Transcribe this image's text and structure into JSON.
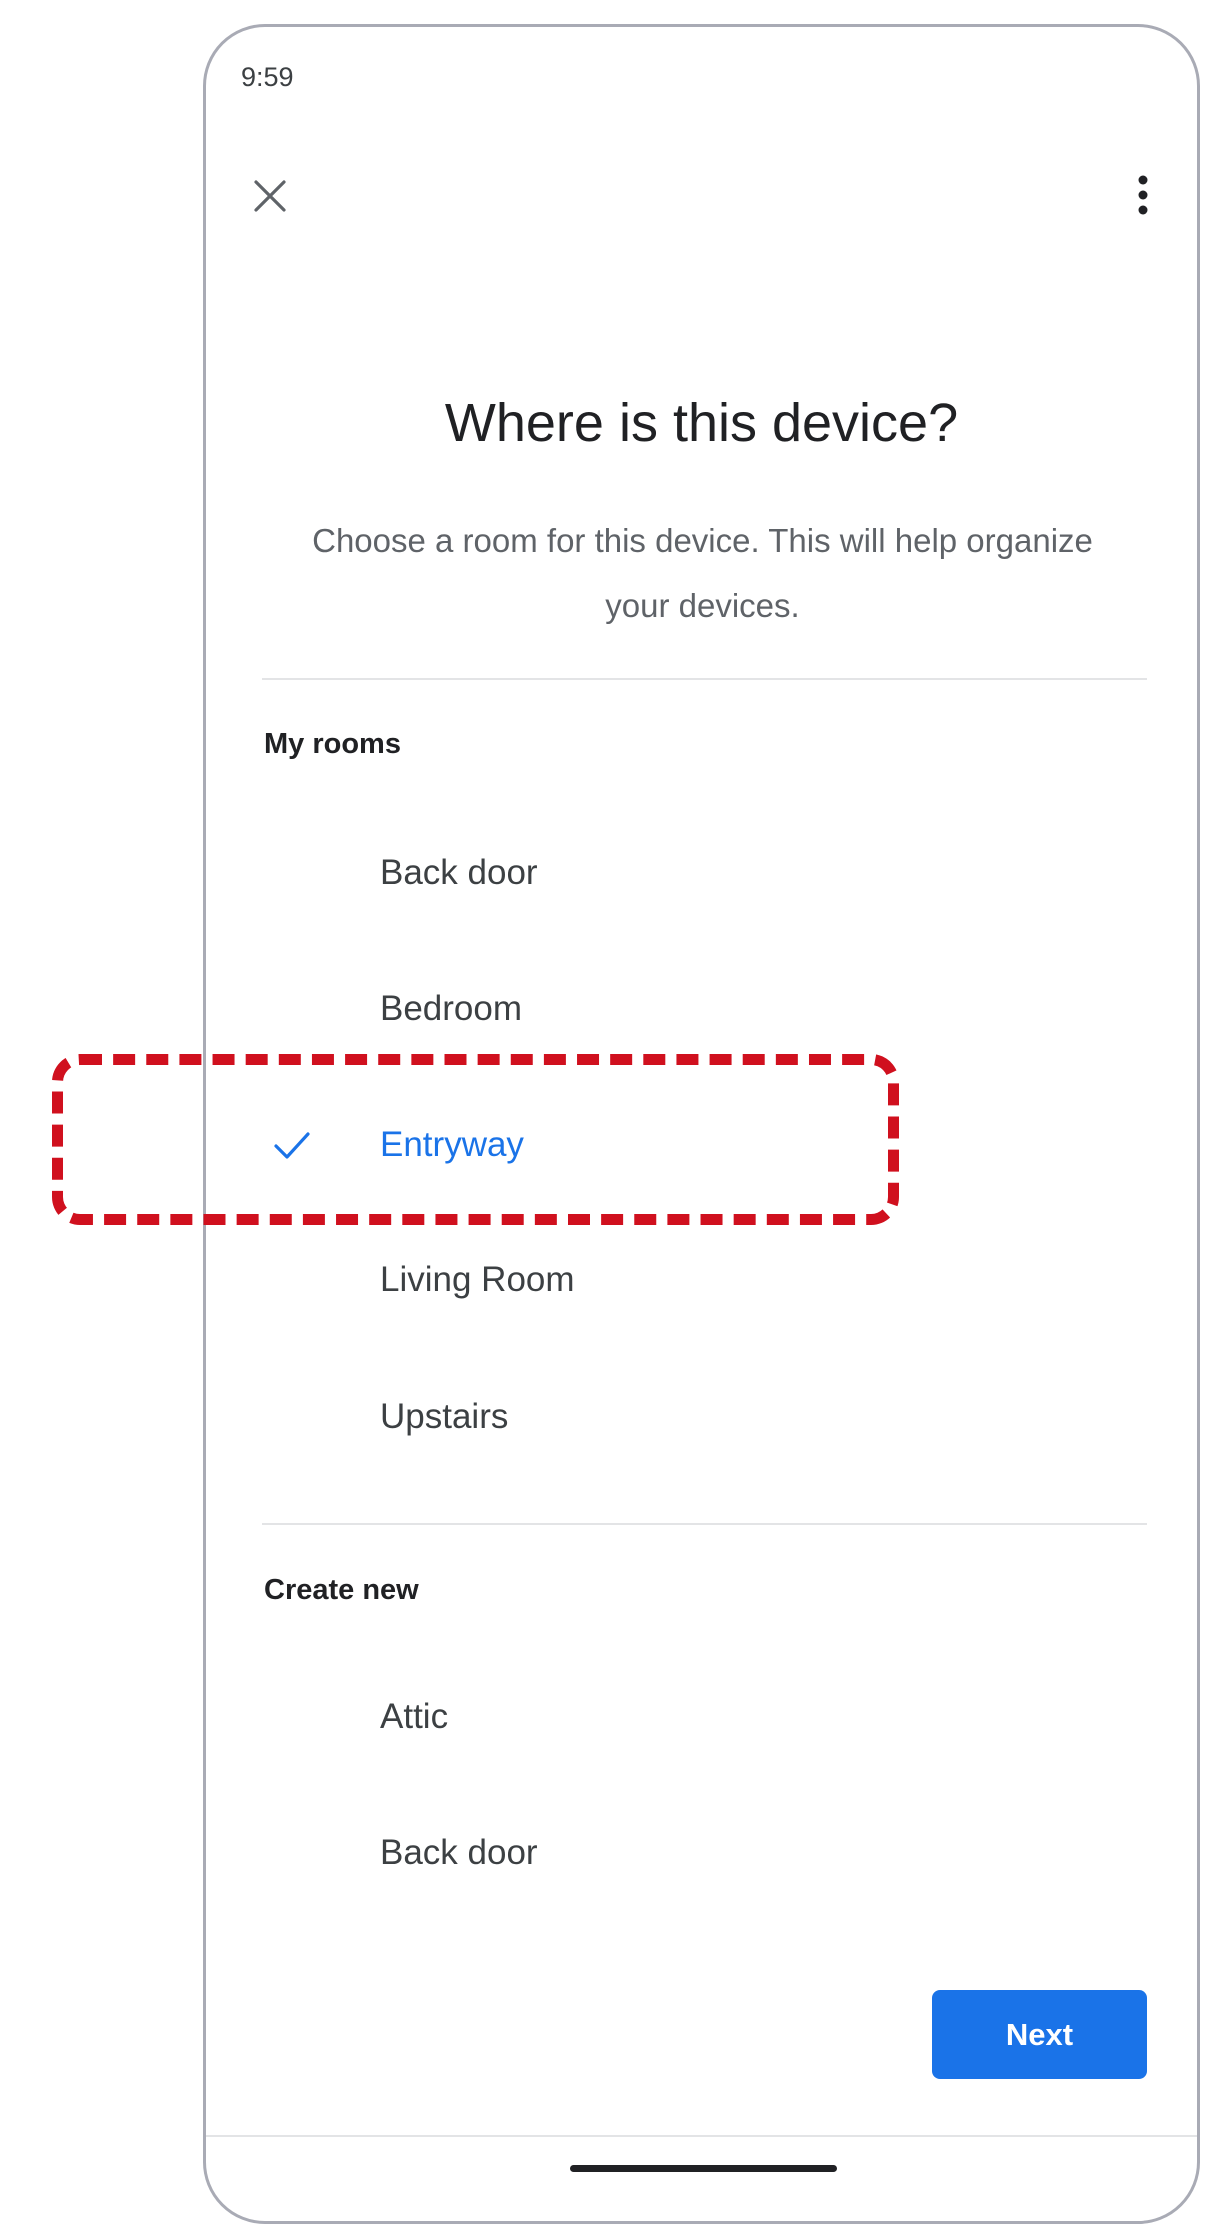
{
  "status_bar": {
    "time": "9:59"
  },
  "header": {
    "close_icon": "close-icon",
    "menu_icon": "more-vert-icon"
  },
  "page": {
    "title": "Where is this device?",
    "subtitle": "Choose a room for this device. This will help organize your devices."
  },
  "my_rooms": {
    "label": "My rooms",
    "items": [
      {
        "label": "Back door",
        "selected": false
      },
      {
        "label": "Bedroom",
        "selected": false
      },
      {
        "label": "Entryway",
        "selected": true
      },
      {
        "label": "Living Room",
        "selected": false
      },
      {
        "label": "Upstairs",
        "selected": false
      }
    ]
  },
  "create_new": {
    "label": "Create new",
    "items": [
      {
        "label": "Attic"
      },
      {
        "label": "Back door"
      }
    ]
  },
  "footer": {
    "next_label": "Next"
  },
  "colors": {
    "accent": "#1a73e8",
    "highlight": "#d0101e",
    "text": "#202124"
  }
}
